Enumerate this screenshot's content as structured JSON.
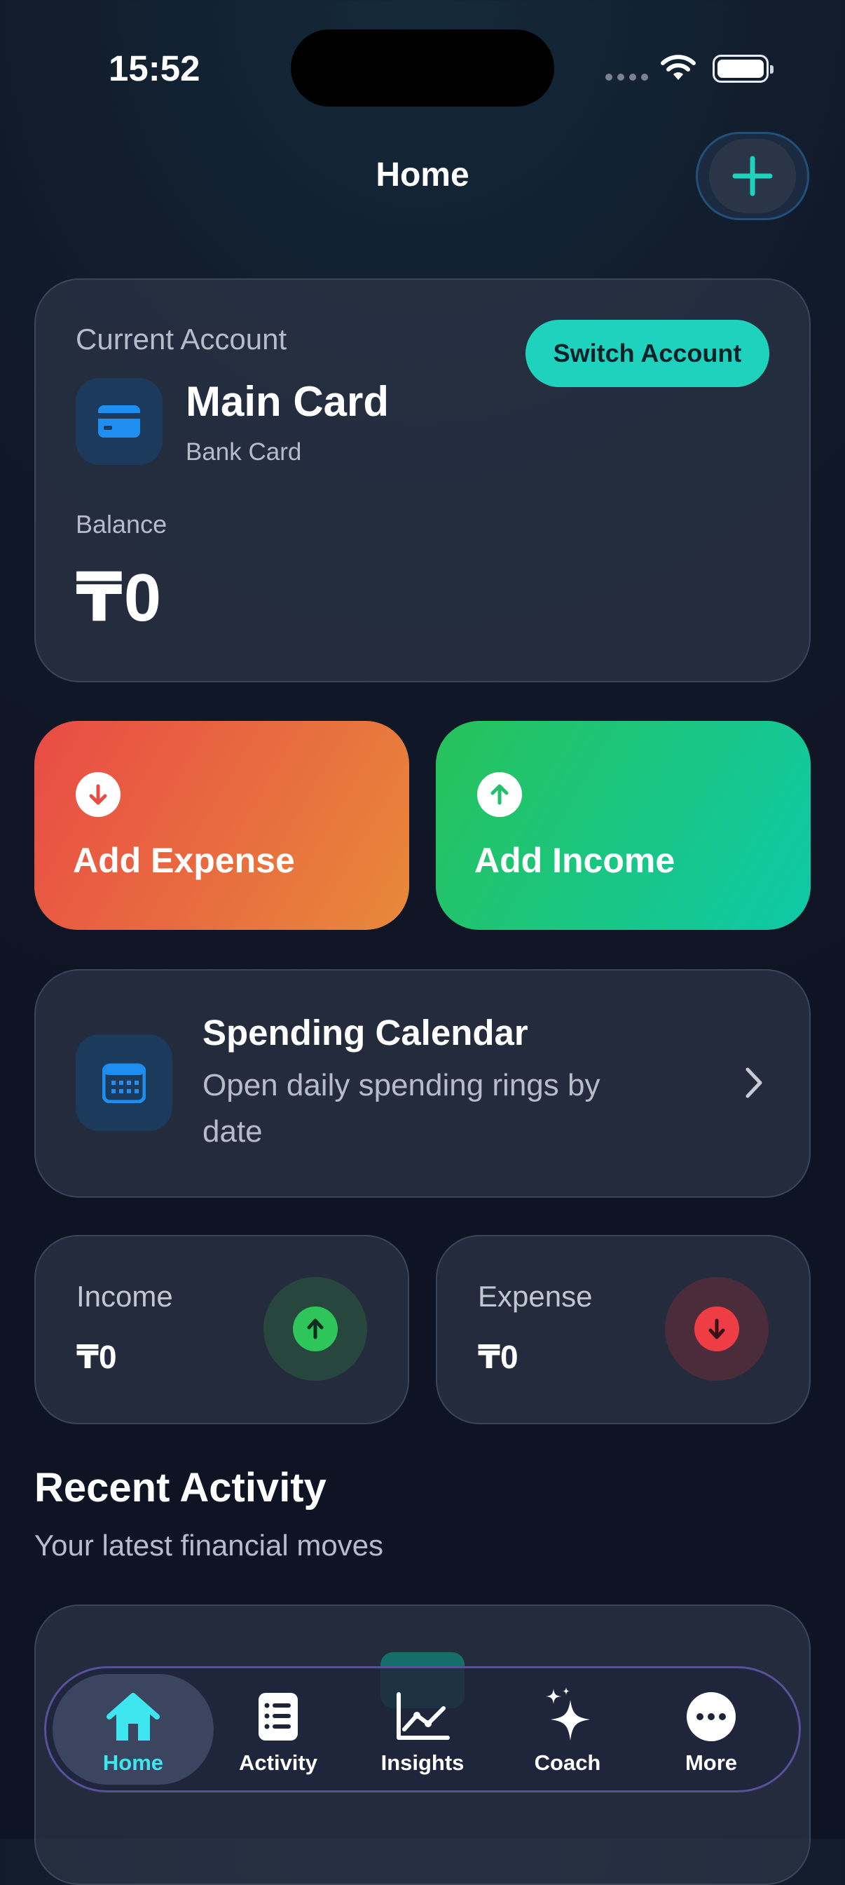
{
  "status_bar": {
    "time": "15:52"
  },
  "header": {
    "title": "Home",
    "add_icon": "plus-icon"
  },
  "account": {
    "section_label": "Current Account",
    "switch_label": "Switch Account",
    "card_icon": "credit-card-icon",
    "card_name": "Main Card",
    "card_type": "Bank Card",
    "balance_label": "Balance",
    "balance_value": "₸0"
  },
  "actions": {
    "expense": {
      "label": "Add Expense",
      "icon": "arrow-down-icon"
    },
    "income": {
      "label": "Add Income",
      "icon": "arrow-up-icon"
    }
  },
  "calendar": {
    "icon": "calendar-icon",
    "title": "Spending Calendar",
    "description": "Open daily spending rings by date"
  },
  "stats": {
    "income": {
      "label": "Income",
      "value": "₸0",
      "color": "#2ec55a"
    },
    "expense": {
      "label": "Expense",
      "value": "₸0",
      "color": "#ef3d45"
    }
  },
  "recent": {
    "title": "Recent Activity",
    "subtitle": "Your latest financial moves"
  },
  "colors": {
    "accent": "#1fd2bd",
    "tab_active": "#3ee6f0"
  },
  "tabs": [
    {
      "label": "Home",
      "icon": "house-icon",
      "active": true
    },
    {
      "label": "Activity",
      "icon": "list-icon",
      "active": false
    },
    {
      "label": "Insights",
      "icon": "chart-icon",
      "active": false
    },
    {
      "label": "Coach",
      "icon": "sparkle-icon",
      "active": false
    },
    {
      "label": "More",
      "icon": "ellipsis-icon",
      "active": false
    }
  ]
}
